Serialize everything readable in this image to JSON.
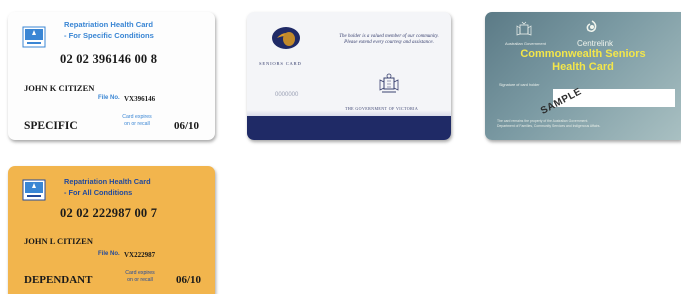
{
  "cards": [
    {
      "header_line1": "Repatriation Health Card",
      "header_line2": "- For Specific Conditions",
      "number": "02 02 396146 00 8",
      "name": "JOHN K CITIZEN",
      "file_no_label": "File No.",
      "file_no": "VX396146",
      "type": "SPECIFIC",
      "expiry_label_line1": "Card expires",
      "expiry_label_line2": "on or recall",
      "expiry": "06/10",
      "background": "#fdfdfd",
      "accent": "#3a86d4"
    },
    {
      "brand": "SENIORS CARD",
      "tagline": "The holder is a valued member of our community. Please extend every courtesy and assistance.",
      "number": "0000000",
      "government": "THE GOVERNMENT OF VICTORIA",
      "band_color": "#1f2a66",
      "logo_icon": "seniors-oval-logo",
      "crest_icon": "victoria-crest"
    },
    {
      "gov_label": "Australian Government",
      "agency": "Centrelink",
      "title_line1": "Commonwealth Seniors",
      "title_line2": "Health Card",
      "signature_label": "Signature of card holder",
      "stamp": "SAMPLE",
      "fine_print_line1": "The card remains the property of the Australian Government.",
      "fine_print_line2": "Department of Families, Community Services and Indigenous Affairs.",
      "title_color": "#f3e64a"
    },
    {
      "header_line1": "Repatriation Health Card",
      "header_line2": "- For All Conditions",
      "number": "02 02 222987 00  7",
      "name": "JOHN L CITIZEN",
      "file_no_label": "File No.",
      "file_no": "VX222987",
      "type": "DEPENDANT",
      "expiry_label_line1": "Card expires",
      "expiry_label_line2": "on or recall",
      "expiry": "06/10",
      "background": "#f2b54d",
      "accent": "#234a9c"
    }
  ]
}
